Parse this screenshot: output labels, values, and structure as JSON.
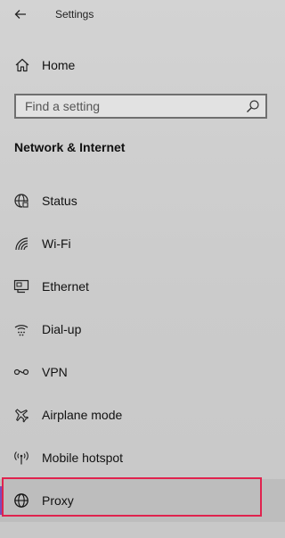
{
  "app": {
    "title": "Settings",
    "back_icon": "back-arrow-icon"
  },
  "home": {
    "label": "Home",
    "icon": "home-icon"
  },
  "search": {
    "placeholder": "Find a setting",
    "value": "",
    "icon": "search-icon"
  },
  "section": {
    "title": "Network & Internet"
  },
  "nav": {
    "items": [
      {
        "label": "Status",
        "icon": "globe-status-icon",
        "selected": false
      },
      {
        "label": "Wi-Fi",
        "icon": "wifi-icon",
        "selected": false
      },
      {
        "label": "Ethernet",
        "icon": "ethernet-icon",
        "selected": false
      },
      {
        "label": "Dial-up",
        "icon": "dialup-icon",
        "selected": false
      },
      {
        "label": "VPN",
        "icon": "vpn-icon",
        "selected": false
      },
      {
        "label": "Airplane mode",
        "icon": "airplane-icon",
        "selected": false
      },
      {
        "label": "Mobile hotspot",
        "icon": "hotspot-icon",
        "selected": false
      },
      {
        "label": "Proxy",
        "icon": "globe-icon",
        "selected": true
      }
    ]
  },
  "colors": {
    "accent": "#7a4bb8",
    "highlight": "#e0234e"
  }
}
